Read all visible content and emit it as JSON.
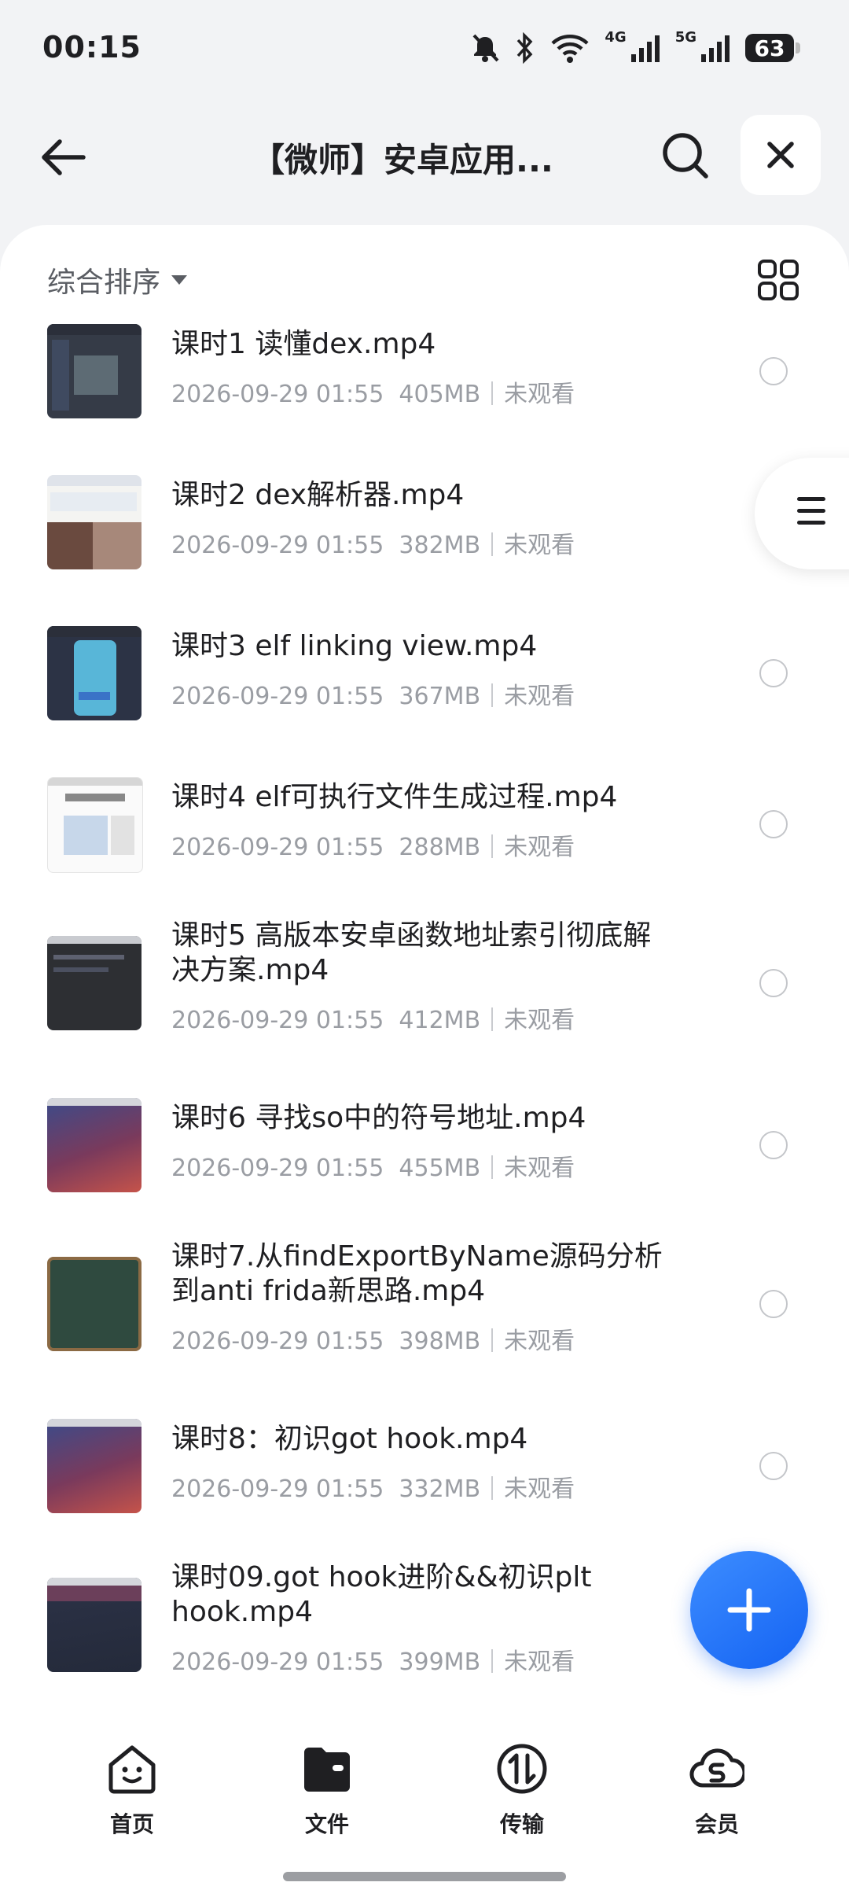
{
  "status": {
    "time": "00:15",
    "network_4g": "4G",
    "network_5g": "5G",
    "battery": "63"
  },
  "header": {
    "title": "【微师】安卓应用..."
  },
  "sort": {
    "label": "综合排序"
  },
  "files": [
    {
      "name": "课时1 读懂dex.mp4",
      "date": "2026-09-29 01:55",
      "size": "405MB",
      "status": "未观看"
    },
    {
      "name": "课时2 dex解析器.mp4",
      "date": "2026-09-29 01:55",
      "size": "382MB",
      "status": "未观看"
    },
    {
      "name": "课时3 elf linking view.mp4",
      "date": "2026-09-29 01:55",
      "size": "367MB",
      "status": "未观看"
    },
    {
      "name": "课时4 elf可执行文件生成过程.mp4",
      "date": "2026-09-29 01:55",
      "size": "288MB",
      "status": "未观看"
    },
    {
      "name": "课时5 高版本安卓函数地址索引彻底解决方案.mp4",
      "date": "2026-09-29 01:55",
      "size": "412MB",
      "status": "未观看"
    },
    {
      "name": "课时6 寻找so中的符号地址.mp4",
      "date": "2026-09-29 01:55",
      "size": "455MB",
      "status": "未观看"
    },
    {
      "name": "课时7.从findExportByName源码分析到anti frida新思路.mp4",
      "date": "2026-09-29 01:55",
      "size": "398MB",
      "status": "未观看"
    },
    {
      "name": "课时8：初识got hook.mp4",
      "date": "2026-09-29 01:55",
      "size": "332MB",
      "status": "未观看"
    },
    {
      "name": "课时09.got hook进阶&&初识plt hook.mp4",
      "date": "2026-09-29 01:55",
      "size": "399MB",
      "status": "未观看"
    }
  ],
  "nav": [
    {
      "label": "首页",
      "icon": "home-face-icon"
    },
    {
      "label": "文件",
      "icon": "folder-icon"
    },
    {
      "label": "传输",
      "icon": "transfer-icon"
    },
    {
      "label": "会员",
      "icon": "cloud-vip-icon"
    }
  ]
}
